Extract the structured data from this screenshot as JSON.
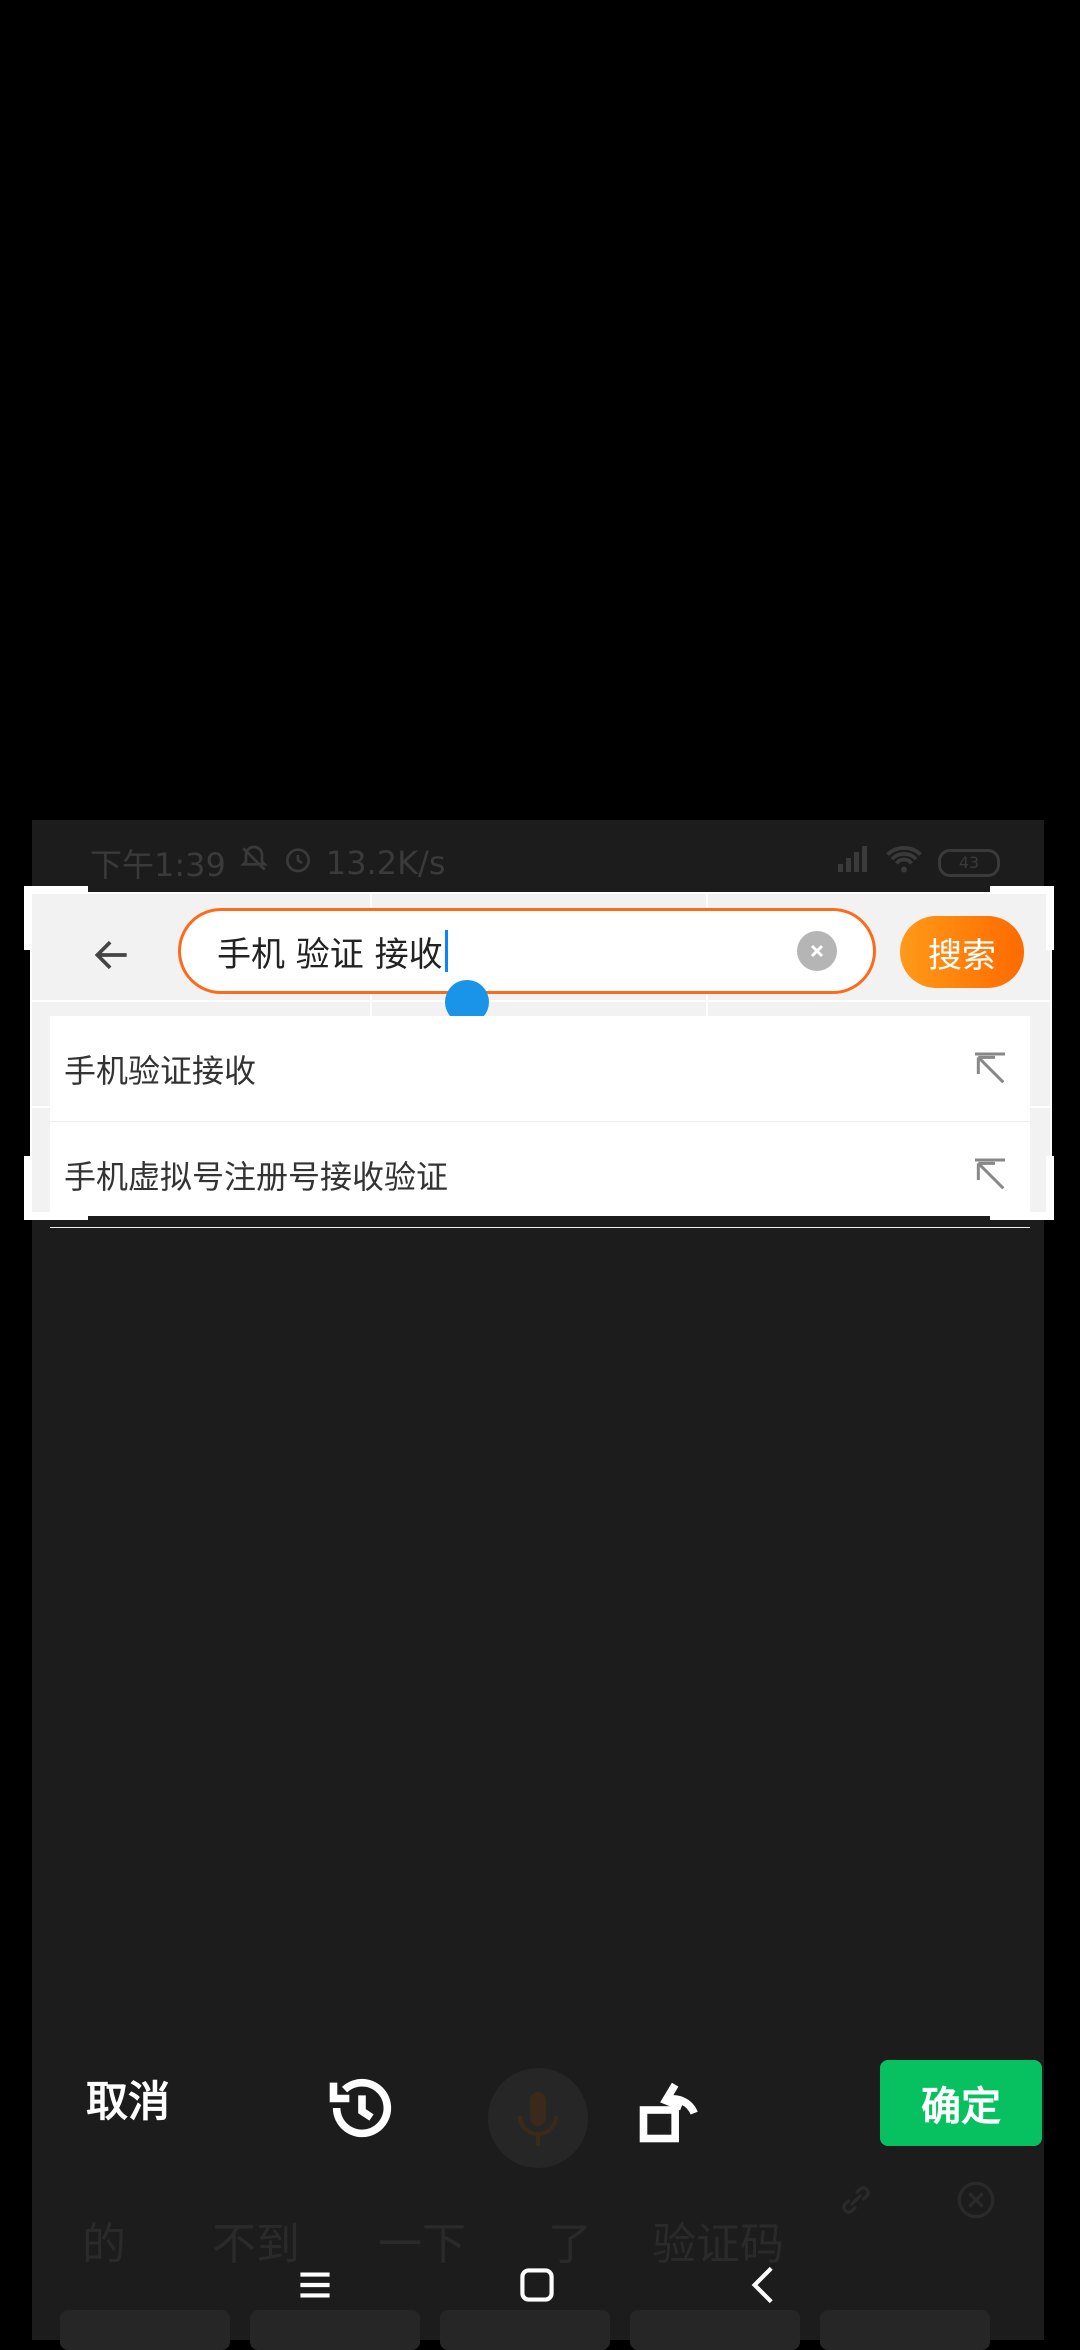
{
  "status_bar": {
    "time": "下午1:39",
    "network_speed": "13.2K/s",
    "battery": "43"
  },
  "search": {
    "query": "手机 验证 接收",
    "button_label": "搜索",
    "back_icon": "arrow-left-icon",
    "clear_icon": "clear-circle-icon"
  },
  "suggestions": [
    {
      "text": "手机验证接收",
      "icon": "arrow-up-left-icon"
    },
    {
      "text": "手机虚拟号注册号接收验证",
      "icon": "arrow-up-left-icon"
    }
  ],
  "editor_bar": {
    "cancel_label": "取消",
    "confirm_label": "确定",
    "history_icon": "history-icon",
    "mic_icon": "mic-icon",
    "rotate_icon": "rotate-icon"
  },
  "candidates": [
    "的",
    "不到",
    "一下",
    "了",
    "验证码"
  ],
  "nav": {
    "menu_icon": "menu-icon",
    "home_icon": "home-icon",
    "back_icon": "back-icon"
  },
  "colors": {
    "accent_orange": "#ff6a00",
    "confirm_green": "#07c160",
    "handle_blue": "#1a94e8"
  }
}
